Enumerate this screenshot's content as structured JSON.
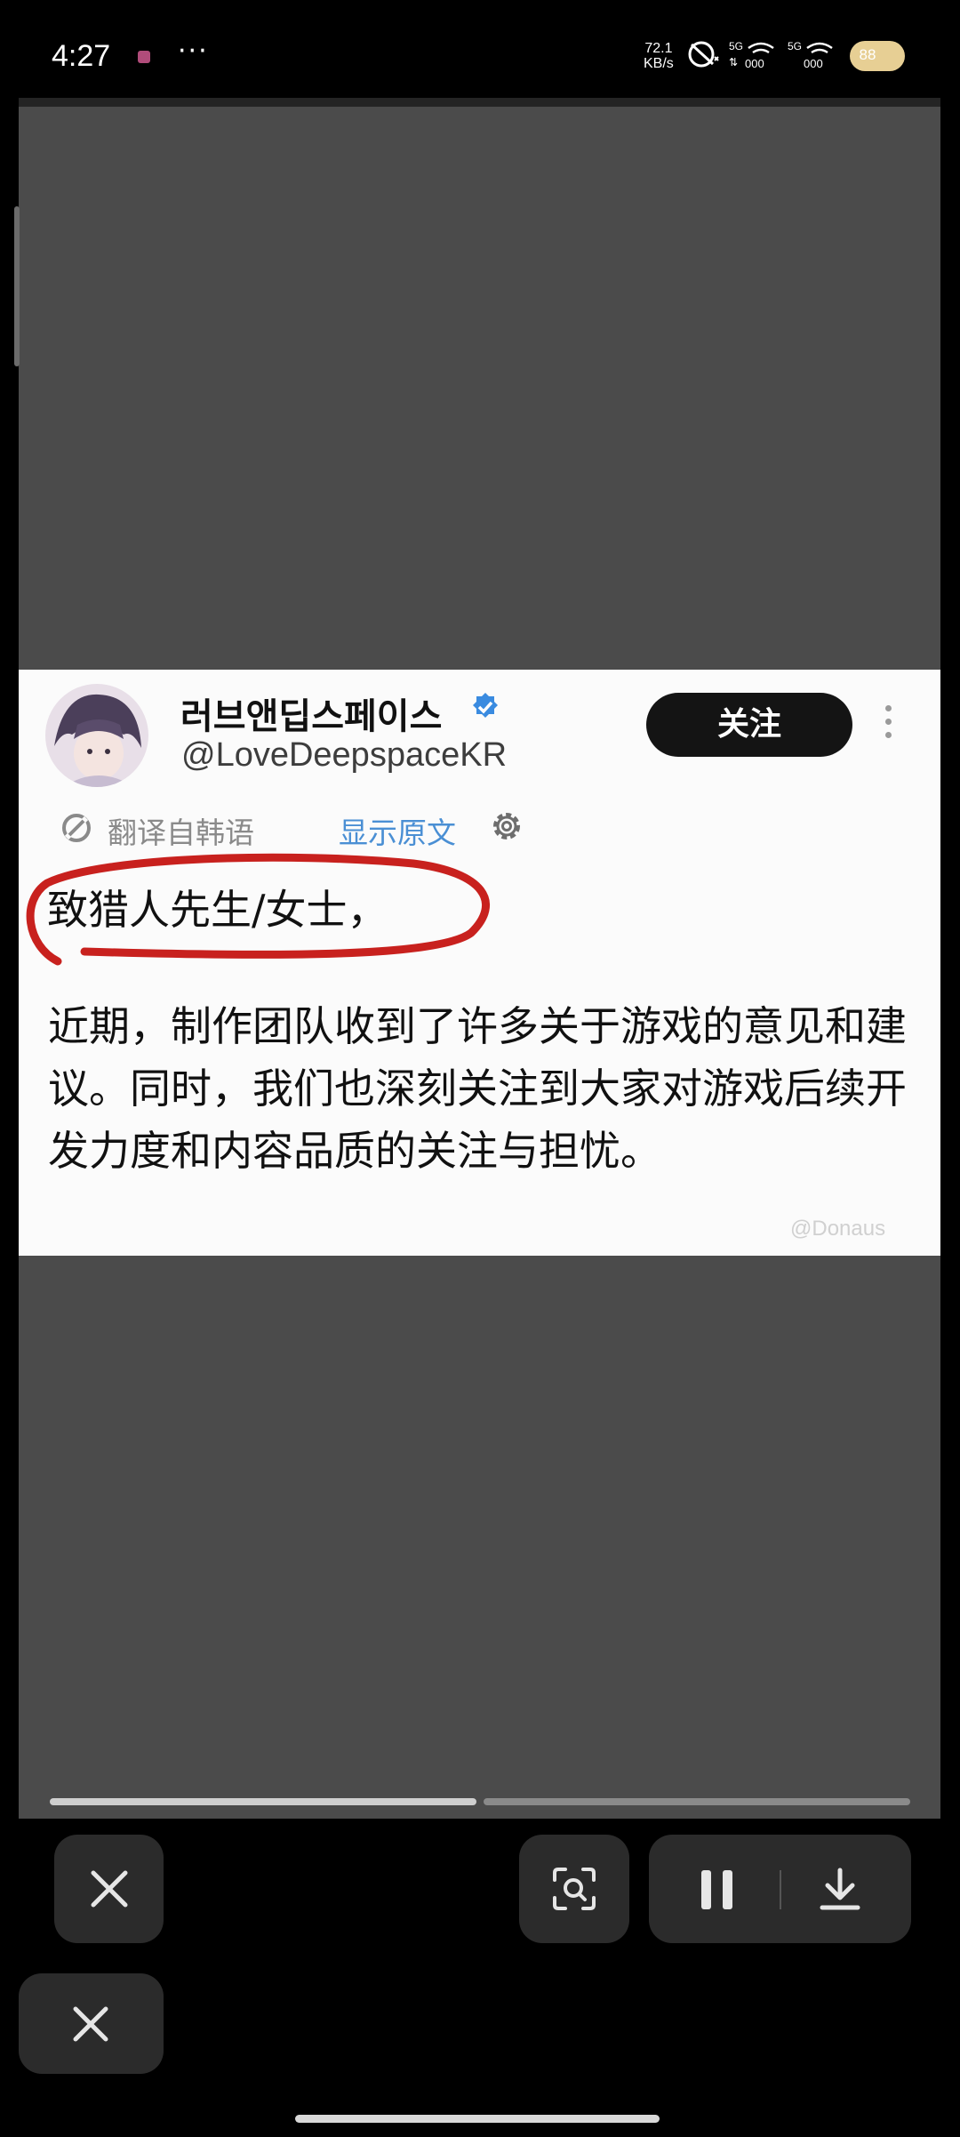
{
  "status_bar": {
    "time": "4:27",
    "dots": "···",
    "network_speed_value": "72.1",
    "network_speed_unit": "KB/s",
    "signal1_label": "5G",
    "signal2_label": "5G",
    "battery_level": "88"
  },
  "post": {
    "author_name": "러브앤딥스페이스",
    "author_handle": "@LoveDeepspaceKR",
    "follow_label": "关注",
    "translate_label": "翻译自韩语",
    "show_original_label": "显示原文",
    "greeting": "致猎人先生/女士，",
    "body": "近期，制作团队收到了许多关于游戏的意见和建议。同时，我们也深刻关注到大家对游戏后续开发力度和内容品质的关注与担忧。",
    "watermark": "@Donaus"
  },
  "playback": {
    "segments": 2,
    "current_segment": 1
  },
  "colors": {
    "background": "#000000",
    "viewer": "#4b4b4b",
    "accent_link": "#4a8fd4",
    "annotation_red": "#c8211e",
    "control_bg": "#2b2b2b"
  },
  "icons": [
    "close-icon",
    "scan-icon",
    "pause-icon",
    "download-icon",
    "close-icon",
    "gear-icon",
    "translate-icon",
    "verified-badge-icon"
  ]
}
